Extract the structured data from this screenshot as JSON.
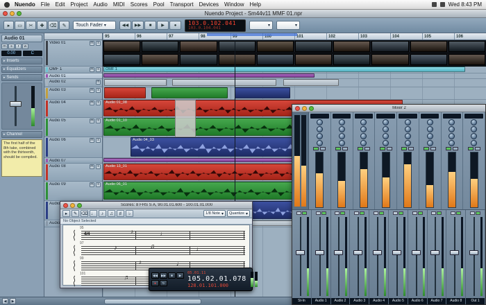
{
  "ui": {
    "mute": "m",
    "solo": "s",
    "read": "r",
    "write": "w"
  },
  "colors": {
    "accent_red": "#c23428",
    "accent_green": "#2f9138",
    "accent_navy": "#2c3f86",
    "accent_purple": "#9a55b0",
    "accent_cyan": "#6fc6d4",
    "meter_orange": "#f09040",
    "led_red": "#ff4430"
  },
  "menu_bar": {
    "items": [
      "Nuendo",
      "File",
      "Edit",
      "Project",
      "Audio",
      "MIDI",
      "Scores",
      "Pool",
      "Transport",
      "Devices",
      "Window",
      "Help"
    ],
    "clock": "Wed 8:43 PM"
  },
  "project_window": {
    "title": "Nuendo Project - Sm44v11 MMF 01.npr"
  },
  "toolbar": {
    "automation_mode": "Touch Fader",
    "tools": [
      {
        "name": "pointer-tool-icon",
        "glyph": "▸"
      },
      {
        "name": "range-tool-icon",
        "glyph": "▭"
      },
      {
        "name": "scissors-tool-icon",
        "glyph": "✂"
      },
      {
        "name": "glue-tool-icon",
        "glyph": "✚"
      },
      {
        "name": "erase-tool-icon",
        "glyph": "⌫"
      },
      {
        "name": "pencil-tool-icon",
        "glyph": "✎"
      }
    ],
    "transport_buttons": [
      {
        "name": "rewind-button",
        "glyph": "◀◀"
      },
      {
        "name": "forward-button",
        "glyph": "▶▶"
      },
      {
        "name": "stop-button",
        "glyph": "■"
      },
      {
        "name": "play-button",
        "glyph": "▶"
      },
      {
        "name": "record-button",
        "glyph": "●"
      }
    ],
    "time_primary": "103.0.102.041",
    "time_secondary": "103.0.104.041"
  },
  "ruler": {
    "ticks": [
      "95",
      "96",
      "97",
      "98",
      "99",
      "100",
      "101",
      "102",
      "103",
      "104",
      "105",
      "106"
    ]
  },
  "inspector": {
    "track_name": "Audio 01",
    "volume": "0.00",
    "pan": "C",
    "sections": [
      "Inserts",
      "Equalizers",
      "Sends",
      "Channel"
    ],
    "notepad": "The first half of the 8th take, combined with the thirteenth, should be compiled."
  },
  "track_list": [
    {
      "name": "Video 01",
      "color": "#3c424a"
    },
    {
      "name": "OMF 1",
      "color": "#6fc6d4"
    },
    {
      "name": "Audio 01",
      "color": "#9a55b0"
    },
    {
      "name": "Audio 02",
      "color": "#a8b4c0"
    },
    {
      "name": "Audio 03",
      "color": "#c2a040"
    },
    {
      "name": "Audio 04",
      "color": "#c23428"
    },
    {
      "name": "Audio 05",
      "color": "#2f9138"
    },
    {
      "name": "Audio 06",
      "color": "#2c3f86"
    },
    {
      "name": "Audio 07",
      "color": "#9a55b0"
    },
    {
      "name": "Audio 08",
      "color": "#c23428"
    },
    {
      "name": "Audio 09",
      "color": "#2f9138"
    },
    {
      "name": "Audio 10",
      "color": "#2c3f86"
    },
    {
      "name": "Audio 11",
      "color": "#8898a8"
    }
  ],
  "clips": {
    "omf_label": "OMF 1",
    "red1_label": "Audio 01_08",
    "green1_label": "Audio 01_10",
    "navy1_label": "Audio 04_03",
    "red2_label": "Audio 13_01",
    "green2_label": "Audio 06_01"
  },
  "video_frames_row1": [
    "#32261c",
    "#1c2a34",
    "#3e2c20",
    "#23303a",
    "#352718",
    "#1e2b36",
    "#3a2a1e",
    "#263340",
    "#30241a",
    "#202d38"
  ],
  "video_frames_row2": [
    "#20303c",
    "#38281c",
    "#1d2b35",
    "#34261a",
    "#243240",
    "#3c2b1f",
    "#1f2d37",
    "#31251b",
    "#223140",
    "#36281d"
  ],
  "mixer": {
    "title": "Mixer 2",
    "top_strips": [
      {
        "level": 62
      },
      {
        "level": 48
      },
      {
        "level": 70
      },
      {
        "level": 55
      },
      {
        "level": 78
      },
      {
        "level": 40
      },
      {
        "level": 65
      },
      {
        "level": 52
      }
    ],
    "lower_channels": [
      {
        "name": "St-In"
      },
      {
        "name": "Audio 1"
      },
      {
        "name": "Audio 2"
      },
      {
        "name": "Audio 3"
      },
      {
        "name": "Audio 4"
      },
      {
        "name": "Audio 5"
      },
      {
        "name": "Audio 6"
      },
      {
        "name": "Audio 7"
      },
      {
        "name": "Audio 8"
      },
      {
        "name": "Out 1"
      }
    ]
  },
  "score_window": {
    "title": "Scores: 8 FHS S A, 90.01.01.600 - 100.01.01.000",
    "toolbar_icons": [
      {
        "name": "pointer-icon",
        "glyph": "▸"
      },
      {
        "name": "pencil-icon",
        "glyph": "✎"
      },
      {
        "name": "erase-icon",
        "glyph": "⌫"
      },
      {
        "name": "quarter-note-icon",
        "glyph": "♩"
      },
      {
        "name": "eighth-note-icon",
        "glyph": "♪"
      },
      {
        "name": "beam-notes-icon",
        "glyph": "♫"
      },
      {
        "name": "sharp-icon",
        "glyph": "♯"
      },
      {
        "name": "flat-icon",
        "glyph": "♭"
      }
    ],
    "note_value": "1/8 Note",
    "quantize": "Quantize",
    "info_line": "No Object Selected",
    "time_sig": "4/4",
    "bar_numbers": [
      "95",
      "97",
      "99",
      "101"
    ],
    "notes": [
      "♪",
      "♩",
      "♪",
      "♫",
      "♩",
      "♪",
      "♩",
      "♫"
    ]
  },
  "transport_panel": {
    "locator": "05.01.11",
    "time_primary": "105.02.01.078",
    "time_secondary": "128.01.101.000",
    "buttons": [
      "◀◀",
      "▶▶",
      "■",
      "▶",
      "●",
      "↻"
    ]
  }
}
